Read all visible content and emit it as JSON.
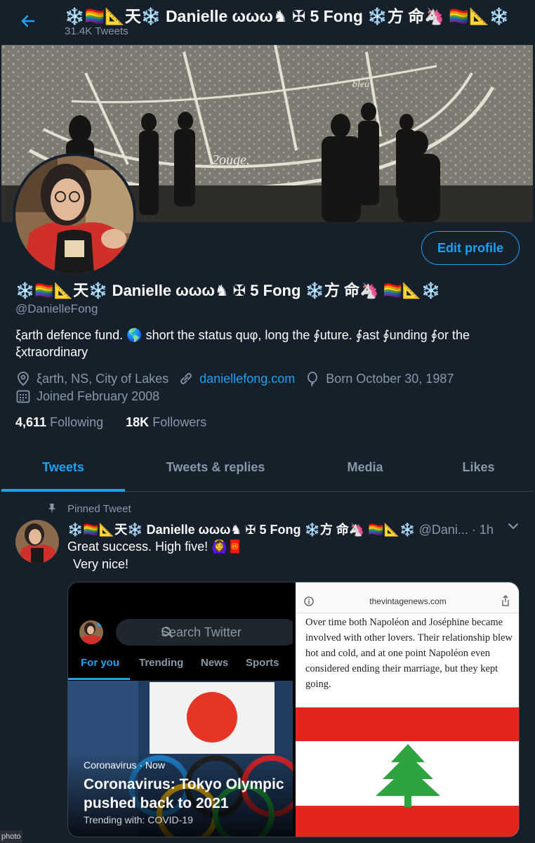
{
  "header": {
    "back_label": "←",
    "name": "❄️🏳️‍🌈📐天❄️ Danielle ωωω♞ ✠ 5 Fong ❄️方 命🦄 🏳️‍🌈📐❄️",
    "tweet_count": "31.4K Tweets"
  },
  "profile": {
    "edit_label": "Edit profile",
    "display_name": "❄️🏳️‍🌈📐天❄️ Danielle ωωω♞ ✠ 5 Fong ❄️方 命🦄 🏳️‍🌈📐❄️",
    "handle": "@DanielleFong",
    "bio": "ξarth defence fund. 🌎 short the status quφ, long the ∮uture. ∮ast ∮unding ∮or the ξxtraordinary",
    "location": "ξarth, NS, City of Lakes",
    "website": "daniellefong.com",
    "birthday": "Born October 30, 1987",
    "joined": "Joined February 2008",
    "following_count": "4,611",
    "following_label": "Following",
    "followers_count": "18K",
    "followers_label": "Followers"
  },
  "tabs": [
    {
      "label": "Tweets",
      "active": true
    },
    {
      "label": "Tweets & replies",
      "active": false
    },
    {
      "label": "Media",
      "active": false
    },
    {
      "label": "Likes",
      "active": false
    }
  ],
  "tweet": {
    "pinned_label": "Pinned Tweet",
    "author_name": "❄️🏳️‍🌈📐天❄️ Danielle ωωω♞ ✠ 5 Fong ❄️方 命🦄 🏳️‍🌈📐❄️",
    "author_handle": "@Dani...",
    "separator": "·",
    "time": "1h",
    "text_line1": "Great success. High five! 🙆‍♀️🧧",
    "text_line2": "Very nice!",
    "media_left": {
      "search_placeholder": "Search Twitter",
      "tabs": [
        "For you",
        "Trending",
        "News",
        "Sports"
      ],
      "category": "Coronavirus · Now",
      "headline": "Coronavirus: Tokyo Olympic pushed back to 2021",
      "trending": "Trending with: COVID-19"
    },
    "media_right": {
      "url": "thevintagenews.com",
      "article_text": "Over time both Napoléon and Joséphine became involved with other lovers. Their relationship blew hot and cold, and at one point Napoléon even considered ending their marriage, but they kept going."
    },
    "photo_tag": "photo"
  },
  "colors": {
    "background": "#15202b",
    "accent": "#1da1f2",
    "muted": "#8899a6",
    "border": "#38444d"
  }
}
